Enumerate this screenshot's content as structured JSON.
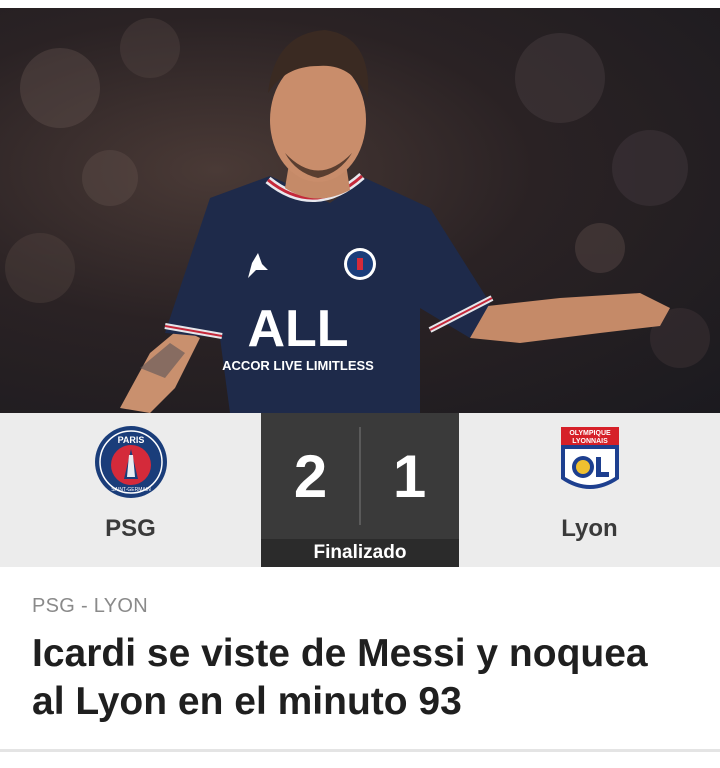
{
  "hero": {
    "jersey_sponsor": "ALL",
    "jersey_sponsor_sub": "ACCOR LIVE LIMITLESS",
    "crest_text": "PARIS"
  },
  "match": {
    "home_team": "PSG",
    "away_team": "Lyon",
    "home_score": "2",
    "away_score": "1",
    "status": "Finalizado",
    "home_crest_text": "PARIS",
    "home_crest_subtext": "SAINT-GERMAIN",
    "away_crest_text_line1": "OLYMPIQUE",
    "away_crest_text_line2": "LYONNAIS"
  },
  "article": {
    "kicker": "PSG - LYON",
    "headline": "Icardi se viste de Messi y noquea al Lyon en el minuto 93"
  },
  "colors": {
    "score_bg": "#3a3a3a",
    "psg_blue": "#1a3d7a",
    "psg_red": "#d42a3a",
    "lyon_red": "#d62028",
    "lyon_blue": "#1d3f8f"
  }
}
